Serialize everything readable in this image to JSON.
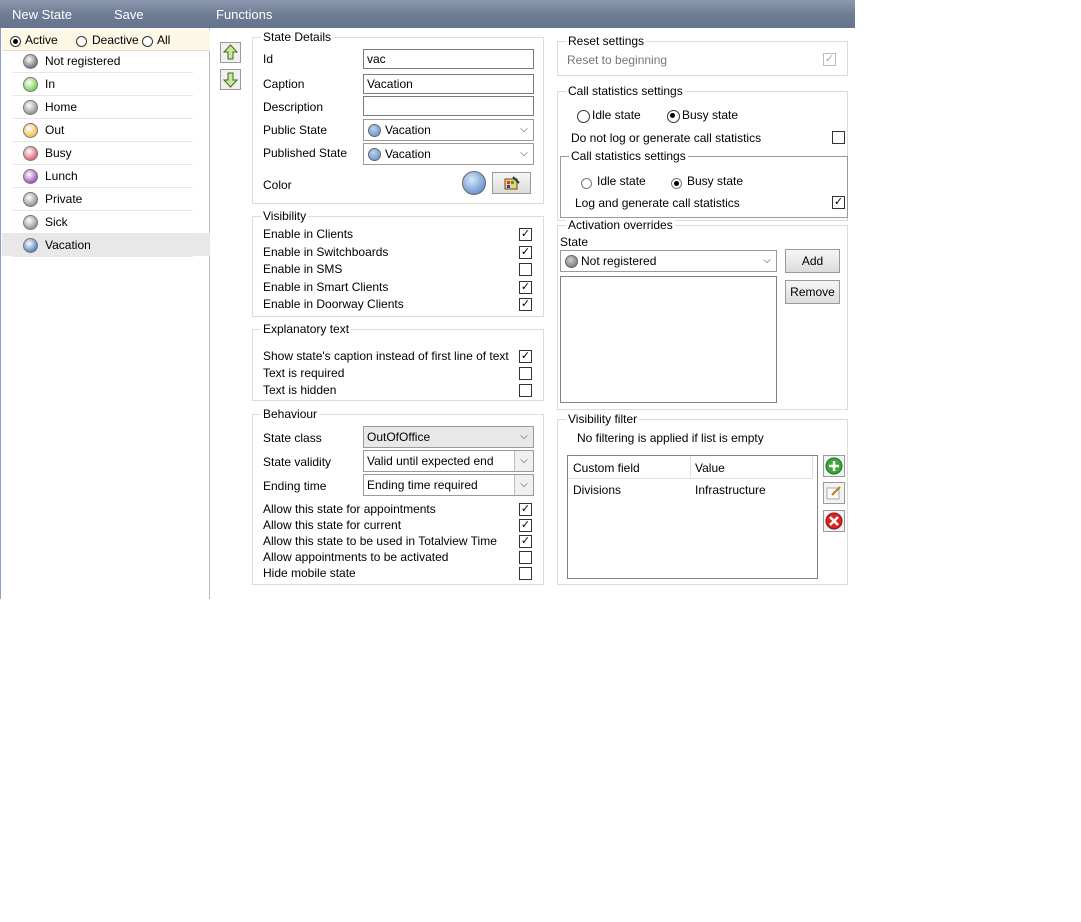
{
  "toolbar": {
    "new_state": "New State",
    "save": "Save",
    "functions": "Functions"
  },
  "filter": {
    "active": "Active",
    "deactive": "Deactive",
    "all": "All",
    "selected": "Active"
  },
  "states": [
    {
      "label": "Not registered",
      "color": "#777777"
    },
    {
      "label": "In",
      "color": "#7ed35a"
    },
    {
      "label": "Home",
      "color": "#9a9a9a"
    },
    {
      "label": "Out",
      "color": "#f2c24a"
    },
    {
      "label": "Busy",
      "color": "#e6697d"
    },
    {
      "label": "Lunch",
      "color": "#a45ab8"
    },
    {
      "label": "Private",
      "color": "#9a9a9a"
    },
    {
      "label": "Sick",
      "color": "#9a9a9a"
    },
    {
      "label": "Vacation",
      "color": "#5b86c8"
    }
  ],
  "selected_state": "Vacation",
  "state_details": {
    "title": "State Details",
    "id_label": "Id",
    "id_value": "vac",
    "caption_label": "Caption",
    "caption_value": "Vacation",
    "description_label": "Description",
    "description_value": "",
    "public_state_label": "Public State",
    "public_state_value": "Vacation",
    "published_state_label": "Published State",
    "published_state_value": "Vacation",
    "color_label": "Color"
  },
  "visibility": {
    "title": "Visibility",
    "items": [
      {
        "label": "Enable in Clients",
        "checked": true
      },
      {
        "label": "Enable in Switchboards",
        "checked": true
      },
      {
        "label": "Enable in SMS",
        "checked": false
      },
      {
        "label": "Enable in Smart Clients",
        "checked": true
      },
      {
        "label": "Enable in Doorway Clients",
        "checked": true
      }
    ]
  },
  "explanatory": {
    "title": "Explanatory text",
    "items": [
      {
        "label": "Show state's caption instead of first line of text",
        "checked": true
      },
      {
        "label": "Text is required",
        "checked": false
      },
      {
        "label": "Text is hidden",
        "checked": false
      }
    ]
  },
  "behaviour": {
    "title": "Behaviour",
    "state_class_label": "State class",
    "state_class_value": "OutOfOffice",
    "state_validity_label": "State validity",
    "state_validity_value": "Valid until expected end",
    "ending_time_label": "Ending time",
    "ending_time_value": "Ending time required",
    "items": [
      {
        "label": "Allow this state for appointments",
        "checked": true
      },
      {
        "label": "Allow this state for current",
        "checked": true
      },
      {
        "label": "Allow this state to be used in Totalview Time",
        "checked": true
      },
      {
        "label": "Allow appointments to be activated",
        "checked": false
      },
      {
        "label": "Hide mobile state",
        "checked": false
      }
    ]
  },
  "reset": {
    "title": "Reset settings",
    "reset_label": "Reset to beginning",
    "checked": true
  },
  "call_stats": {
    "title": "Call statistics settings",
    "idle": "Idle state",
    "busy": "Busy state",
    "selected": "Busy state",
    "no_log_label": "Do not log or generate call statistics",
    "no_log_checked": false
  },
  "call_stats_inner": {
    "title": "Call statistics settings",
    "idle": "Idle state",
    "busy": "Busy state",
    "selected": "Busy state",
    "log_label": "Log and generate call statistics",
    "log_checked": true
  },
  "activation": {
    "title": "Activation overrides",
    "state_label": "State",
    "state_value": "Not registered",
    "add": "Add",
    "remove": "Remove"
  },
  "visibility_filter": {
    "title": "Visibility filter",
    "note": "No filtering is applied if list is empty",
    "columns": [
      "Custom field",
      "Value"
    ],
    "rows": [
      [
        "Divisions",
        "Infrastructure"
      ]
    ]
  }
}
